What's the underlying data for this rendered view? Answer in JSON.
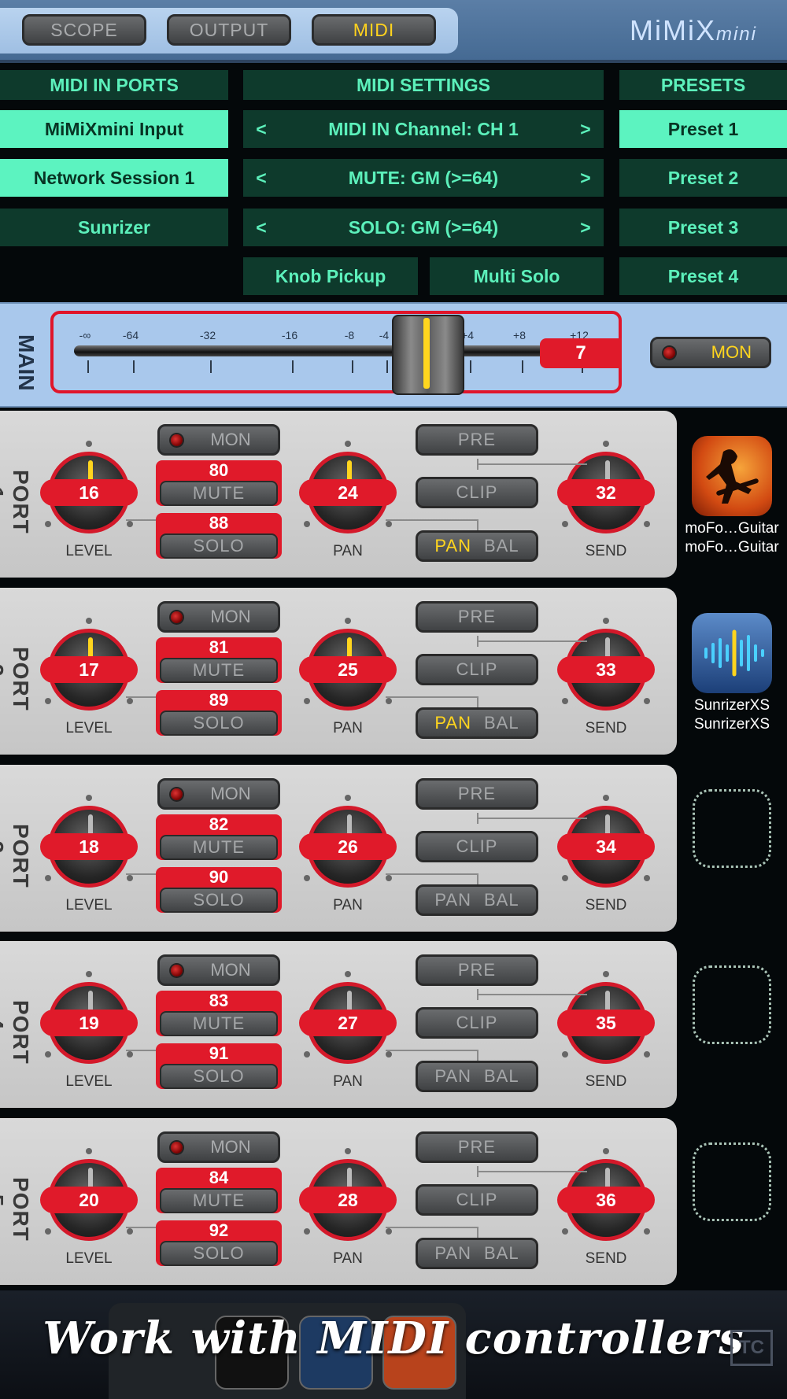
{
  "tabs": {
    "scope": "SCOPE",
    "output": "OUTPUT",
    "midi": "MIDI",
    "active": "MIDI"
  },
  "logo": {
    "main": "MiMiX",
    "sub": "mini"
  },
  "midi_in_ports": {
    "title": "MIDI IN PORTS",
    "items": [
      {
        "label": "MiMiXmini Input",
        "selected": true
      },
      {
        "label": "Network Session 1",
        "selected": true
      },
      {
        "label": "Sunrizer",
        "selected": false
      }
    ]
  },
  "midi_settings": {
    "title": "MIDI SETTINGS",
    "rows": [
      {
        "label": "MIDI IN Channel: CH 1",
        "left": "<",
        "right": ">"
      },
      {
        "label": "MUTE: GM (>=64)",
        "left": "<",
        "right": ">"
      },
      {
        "label": "SOLO: GM (>=64)",
        "left": "<",
        "right": ">"
      }
    ],
    "knob_pickup": "Knob Pickup",
    "multi_solo": "Multi Solo"
  },
  "presets": {
    "title": "PRESETS",
    "items": [
      {
        "label": "Preset 1",
        "selected": true
      },
      {
        "label": "Preset 2",
        "selected": false
      },
      {
        "label": "Preset 3",
        "selected": false
      },
      {
        "label": "Preset 4",
        "selected": false
      }
    ]
  },
  "main": {
    "label": "MAIN",
    "scale": [
      "-∞",
      "-64",
      "-32",
      "-16",
      "-8",
      "-4",
      "+4",
      "+8",
      "+12"
    ],
    "value": "7",
    "mon": "MON"
  },
  "ports": [
    {
      "label": "PORT 1",
      "level": "16",
      "mute_cc": "80",
      "solo_cc": "88",
      "pan": "24",
      "send": "32",
      "mon": "MON",
      "mute": "MUTE",
      "solo": "SOLO",
      "pre": "PRE",
      "clip": "CLIP",
      "pan_btn": "PAN",
      "bal_btn": "BAL",
      "level_label": "LEVEL",
      "pan_label": "PAN",
      "send_label": "SEND",
      "pan_active": true,
      "app": {
        "name1": "moFo…Guitar",
        "name2": "moFo…Guitar",
        "icon": "guitarist-icon"
      }
    },
    {
      "label": "PORT 2",
      "level": "17",
      "mute_cc": "81",
      "solo_cc": "89",
      "pan": "25",
      "send": "33",
      "mon": "MON",
      "mute": "MUTE",
      "solo": "SOLO",
      "pre": "PRE",
      "clip": "CLIP",
      "pan_btn": "PAN",
      "bal_btn": "BAL",
      "level_label": "LEVEL",
      "pan_label": "PAN",
      "send_label": "SEND",
      "pan_active": true,
      "app": {
        "name1": "SunrizerXS",
        "name2": "SunrizerXS",
        "icon": "waveform-icon"
      }
    },
    {
      "label": "PORT 3",
      "level": "18",
      "mute_cc": "82",
      "solo_cc": "90",
      "pan": "26",
      "send": "34",
      "mon": "MON",
      "mute": "MUTE",
      "solo": "SOLO",
      "pre": "PRE",
      "clip": "CLIP",
      "pan_btn": "PAN",
      "bal_btn": "BAL",
      "level_label": "LEVEL",
      "pan_label": "PAN",
      "send_label": "SEND",
      "pan_active": false,
      "app": null
    },
    {
      "label": "PORT 4",
      "level": "19",
      "mute_cc": "83",
      "solo_cc": "91",
      "pan": "27",
      "send": "35",
      "mon": "MON",
      "mute": "MUTE",
      "solo": "SOLO",
      "pre": "PRE",
      "clip": "CLIP",
      "pan_btn": "PAN",
      "bal_btn": "BAL",
      "level_label": "LEVEL",
      "pan_label": "PAN",
      "send_label": "SEND",
      "pan_active": false,
      "app": null
    },
    {
      "label": "PORT 5",
      "level": "20",
      "mute_cc": "84",
      "solo_cc": "92",
      "pan": "28",
      "send": "36",
      "mon": "MON",
      "mute": "MUTE",
      "solo": "SOLO",
      "pre": "PRE",
      "clip": "CLIP",
      "pan_btn": "PAN",
      "bal_btn": "BAL",
      "level_label": "LEVEL",
      "pan_label": "PAN",
      "send_label": "SEND",
      "pan_active": false,
      "app": null
    }
  ],
  "caption": "Work with MIDI controllers",
  "colors": {
    "accent_red": "#e01a2a",
    "midi_green": "#5cf0bb",
    "yellow": "#ffd51e",
    "main_blue": "#a9c8ec"
  }
}
